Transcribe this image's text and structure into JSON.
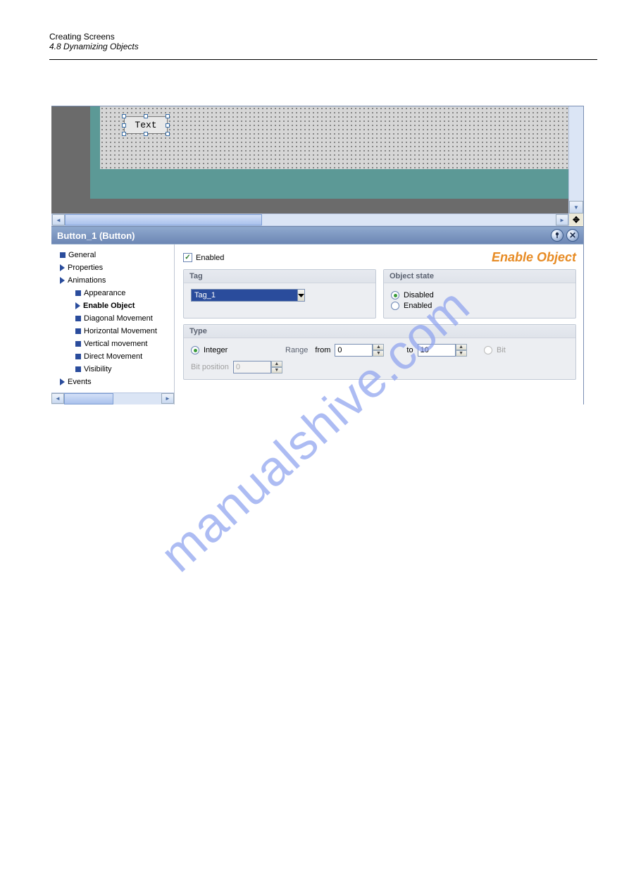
{
  "header": {
    "title": "Creating Screens",
    "subtitle": "4.8 Dynamizing Objects"
  },
  "canvas": {
    "button_text": "Text"
  },
  "panel_title": "Button_1 (Button)",
  "tree": {
    "items": [
      {
        "label": "General",
        "type": "sq"
      },
      {
        "label": "Properties",
        "type": "arw"
      },
      {
        "label": "Animations",
        "type": "arw"
      },
      {
        "label": "Appearance",
        "type": "sq",
        "indent": true
      },
      {
        "label": "Enable Object",
        "type": "arw",
        "indent": true,
        "selected": true
      },
      {
        "label": "Diagonal Movement",
        "type": "sq",
        "indent": true
      },
      {
        "label": "Horizontal Movement",
        "type": "sq",
        "indent": true
      },
      {
        "label": "Vertical movement",
        "type": "sq",
        "indent": true
      },
      {
        "label": "Direct Movement",
        "type": "sq",
        "indent": true
      },
      {
        "label": "Visibility",
        "type": "sq",
        "indent": true
      },
      {
        "label": "Events",
        "type": "arw"
      }
    ]
  },
  "form": {
    "enabled_label": "Enabled",
    "page_title": "Enable Object",
    "tag_group": "Tag",
    "tag_value": "Tag_1",
    "object_state_group": "Object state",
    "state_disabled": "Disabled",
    "state_enabled": "Enabled",
    "type_group": "Type",
    "type_integer": "Integer",
    "type_bit": "Bit",
    "bit_position_label": "Bit position",
    "bit_position_value": "0",
    "range_label": "Range",
    "from_label": "from",
    "from_value": "0",
    "to_label": "to",
    "to_value": "10"
  },
  "watermark": "manualshive.com"
}
